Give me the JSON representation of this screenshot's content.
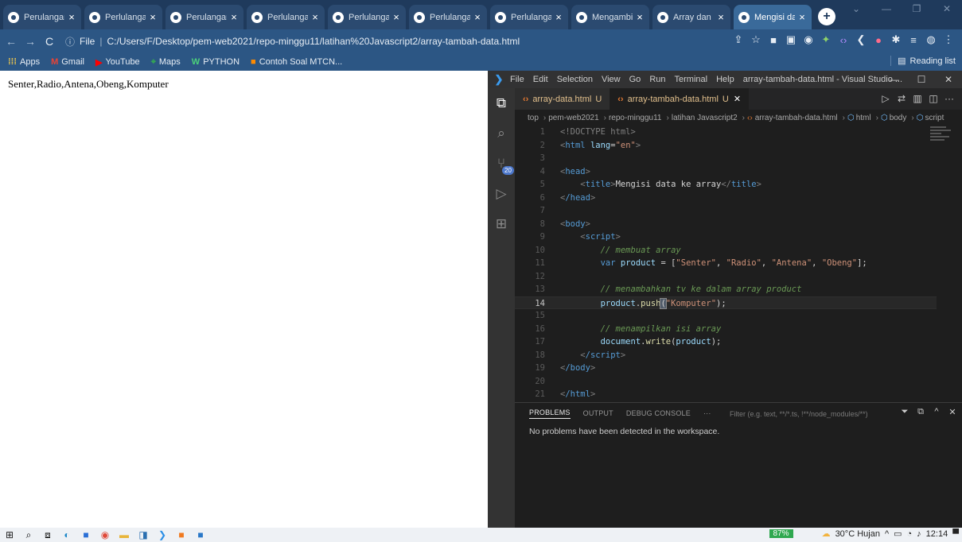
{
  "browser": {
    "tabs": [
      {
        "title": "Perulangan"
      },
      {
        "title": "Perlulangan"
      },
      {
        "title": "Perulangan"
      },
      {
        "title": "Perlulangan"
      },
      {
        "title": "Perlulangan"
      },
      {
        "title": "Perlulangan"
      },
      {
        "title": "Perlulangan"
      },
      {
        "title": "Mengambil"
      },
      {
        "title": "Array dan"
      },
      {
        "title": "Mengisi da"
      }
    ],
    "active_tab_index": 9,
    "url_prefix": "File",
    "url": "C:/Users/F/Desktop/pem-web2021/repo-minggu11/latihan%20Javascript2/array-tambah-data.html",
    "bookmarks": [
      {
        "label": "Apps",
        "icon": "apps-grid-icon"
      },
      {
        "label": "Gmail",
        "icon": "gmail-icon"
      },
      {
        "label": "YouTube",
        "icon": "youtube-icon"
      },
      {
        "label": "Maps",
        "icon": "maps-icon"
      },
      {
        "label": "PYTHON",
        "icon": "python-bookmark-icon"
      },
      {
        "label": "Contoh Soal MTCN...",
        "icon": "blogger-icon"
      }
    ],
    "reading_list": "Reading list"
  },
  "page": {
    "output_text": "Senter,Radio,Antena,Obeng,Komputer"
  },
  "vscode": {
    "menu": [
      "File",
      "Edit",
      "Selection",
      "View",
      "Go",
      "Run",
      "Terminal",
      "Help"
    ],
    "window_title": "array-tambah-data.html - Visual Studio ...",
    "source_control_badge": "20",
    "editor_tabs": [
      {
        "name": "array-data.html",
        "status": "U",
        "active": false
      },
      {
        "name": "array-tambah-data.html",
        "status": "U",
        "active": true
      }
    ],
    "breadcrumbs": [
      "top",
      "pem-web2021",
      "repo-minggu11",
      "latihan Javascript2",
      "array-tambah-data.html",
      "html",
      "body",
      "script"
    ],
    "current_line": "14",
    "line_numbers": [
      "1",
      "2",
      "3",
      "4",
      "5",
      "6",
      "7",
      "8",
      "9",
      "10",
      "11",
      "12",
      "13",
      "14",
      "15",
      "16",
      "17",
      "18",
      "19",
      "20",
      "21"
    ],
    "panel_tabs": [
      "PROBLEMS",
      "OUTPUT",
      "DEBUG CONSOLE",
      "···"
    ],
    "panel_filter_placeholder": "Filter (e.g. text, **/*.ts, !**/node_modules/**)",
    "panel_message": "No problems have been detected in the workspace."
  },
  "code": {
    "l1_doctype": "<!DOCTYPE html>",
    "l2_open": "<",
    "l2_tag": "html",
    "l2_attr": " lang",
    "l2_eq": "=",
    "l2_val": "\"en\"",
    "l2_close": ">",
    "l4_head": "head",
    "l5_title": "title",
    "l5_text": "Mengisi data ke array",
    "l6_head": "/head",
    "l8_body": "body",
    "l9_script": "script",
    "l10_comment": "// membuat array",
    "l11_kw": "var",
    "l11_var": " product",
    "l11_eq": " = [",
    "l11_s1": "\"Senter\"",
    "l11_s2": "\"Radio\"",
    "l11_s3": "\"Antena\"",
    "l11_s4": "\"Obeng\"",
    "l11_end": "];",
    "l13_comment": "// menambahkan tv ke dalam array product",
    "l14_var": "product",
    "l14_dot": ".",
    "l14_fn": "push",
    "l14_paren1": "(",
    "l14_str": "\"Komputer\"",
    "l14_paren2": ");",
    "l16_comment": "// menampilkan isi array",
    "l17_var": "document",
    "l17_fn": "write",
    "l17_arg": "product",
    "l18_script": "/script",
    "l19_body": "/body",
    "l21_html": "/html"
  },
  "taskbar": {
    "battery": "87%",
    "weather": "30°C  Hujan",
    "time": "12:14"
  },
  "colors": {
    "chrome_frame": "#1f3a5c",
    "chrome_toolbar": "#2c5684",
    "vscode_bg": "#1e1e1e",
    "vscode_accent": "#3b9cf0",
    "untracked_file": "#e2c08d"
  }
}
